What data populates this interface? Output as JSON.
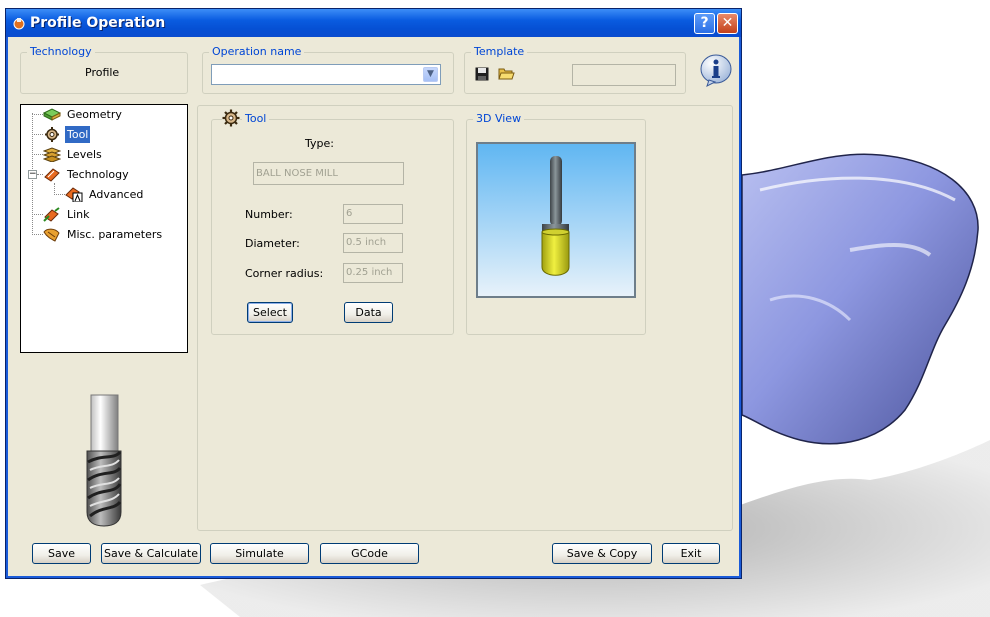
{
  "window": {
    "title": "Profile Operation"
  },
  "technology_group": {
    "label": "Technology",
    "value": "Profile"
  },
  "operation_name": {
    "label": "Operation name",
    "value": ""
  },
  "template": {
    "label": "Template",
    "value": ""
  },
  "tree": {
    "items": [
      {
        "label": "Geometry",
        "icon": "geometry-icon"
      },
      {
        "label": "Tool",
        "icon": "tool-gear-icon",
        "selected": true
      },
      {
        "label": "Levels",
        "icon": "levels-icon"
      },
      {
        "label": "Technology",
        "icon": "technology-icon",
        "expanded": true
      },
      {
        "label": "Advanced",
        "icon": "advanced-icon"
      },
      {
        "label": "Link",
        "icon": "link-icon"
      },
      {
        "label": "Misc. parameters",
        "icon": "misc-icon"
      }
    ]
  },
  "tool_panel": {
    "group_label": "Tool",
    "type_label": "Type:",
    "type_value": "BALL NOSE MILL",
    "number_label": "Number:",
    "number_value": "6",
    "diameter_label": "Diameter:",
    "diameter_value": "0.5 inch",
    "corner_radius_label": "Corner radius:",
    "corner_radius_value": "0.25 inch",
    "select_button": "Select",
    "data_button": "Data"
  },
  "view3d": {
    "label": "3D View"
  },
  "buttons": {
    "save": "Save",
    "save_calculate": "Save & Calculate",
    "simulate": "Simulate",
    "gcode": "GCode",
    "save_copy": "Save & Copy",
    "exit": "Exit"
  },
  "title_buttons": {
    "help": "?",
    "close": "✕"
  }
}
